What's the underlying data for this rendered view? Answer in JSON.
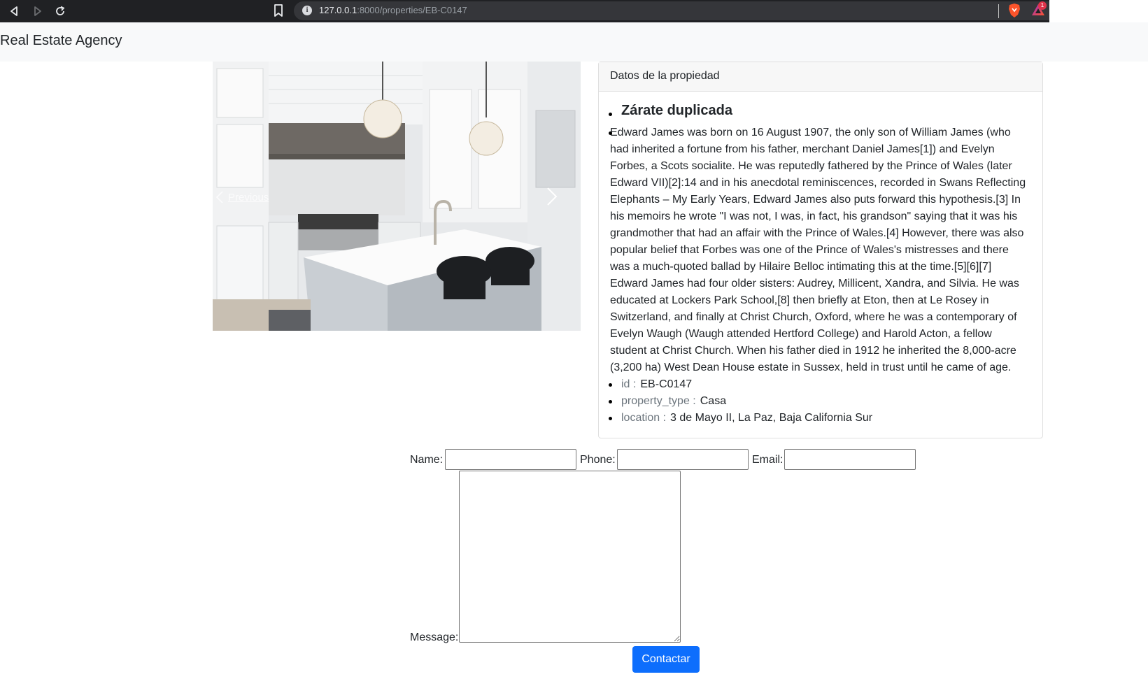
{
  "browser": {
    "url_host": "127.0.0.1",
    "url_rest": ":8000/properties/EB-C0147",
    "rewards_badge": "1",
    "icons": [
      "back-icon",
      "forward-icon",
      "reload-icon",
      "bookmark-icon",
      "info-icon",
      "brave-shield-icon",
      "brave-rewards-icon"
    ]
  },
  "navbar": {
    "brand": "Real Estate Agency"
  },
  "carousel": {
    "prev_label": "Previous",
    "icons": [
      "chevron-left-icon",
      "chevron-right-icon"
    ]
  },
  "card": {
    "header": "Datos de la propiedad",
    "title": "Zárate duplicada",
    "description": "Edward James was born on 16 August 1907, the only son of William James (who had inherited a fortune from his father, merchant Daniel James[1]) and Evelyn Forbes, a Scots socialite. He was reputedly fathered by the Prince of Wales (later Edward VII)[2]:14 and in his anecdotal reminiscences, recorded in Swans Reflecting Elephants – My Early Years, Edward James also puts forward this hypothesis.[3] In his memoirs he wrote \"I was not, I was, in fact, his grandson\" saying that it was his grandmother that had an affair with the Prince of Wales.[4] However, there was also popular belief that Forbes was one of the Prince of Wales's mistresses and there was a much-quoted ballad by Hilaire Belloc intimating this at the time.[5][6][7] Edward James had four older sisters: Audrey, Millicent, Xandra, and Silvia. He was educated at Lockers Park School,[8] then briefly at Eton, then at Le Rosey in Switzerland, and finally at Christ Church, Oxford, where he was a contemporary of Evelyn Waugh (Waugh attended Hertford College) and Harold Acton, a fellow student at Christ Church. When his father died in 1912 he inherited the 8,000-acre (3,200 ha) West Dean House estate in Sussex, held in trust until he came of age.",
    "props": [
      {
        "key": "id :",
        "value": "EB-C0147"
      },
      {
        "key": "property_type :",
        "value": "Casa"
      },
      {
        "key": "location :",
        "value": "3 de Mayo II, La Paz, Baja California Sur"
      }
    ]
  },
  "form": {
    "name_label": "Name:",
    "phone_label": "Phone:",
    "email_label": "Email:",
    "message_label": "Message:",
    "name_value": "",
    "phone_value": "",
    "email_value": "",
    "message_value": "",
    "submit_label": "Contactar",
    "submit_color": "#0d6efd"
  }
}
